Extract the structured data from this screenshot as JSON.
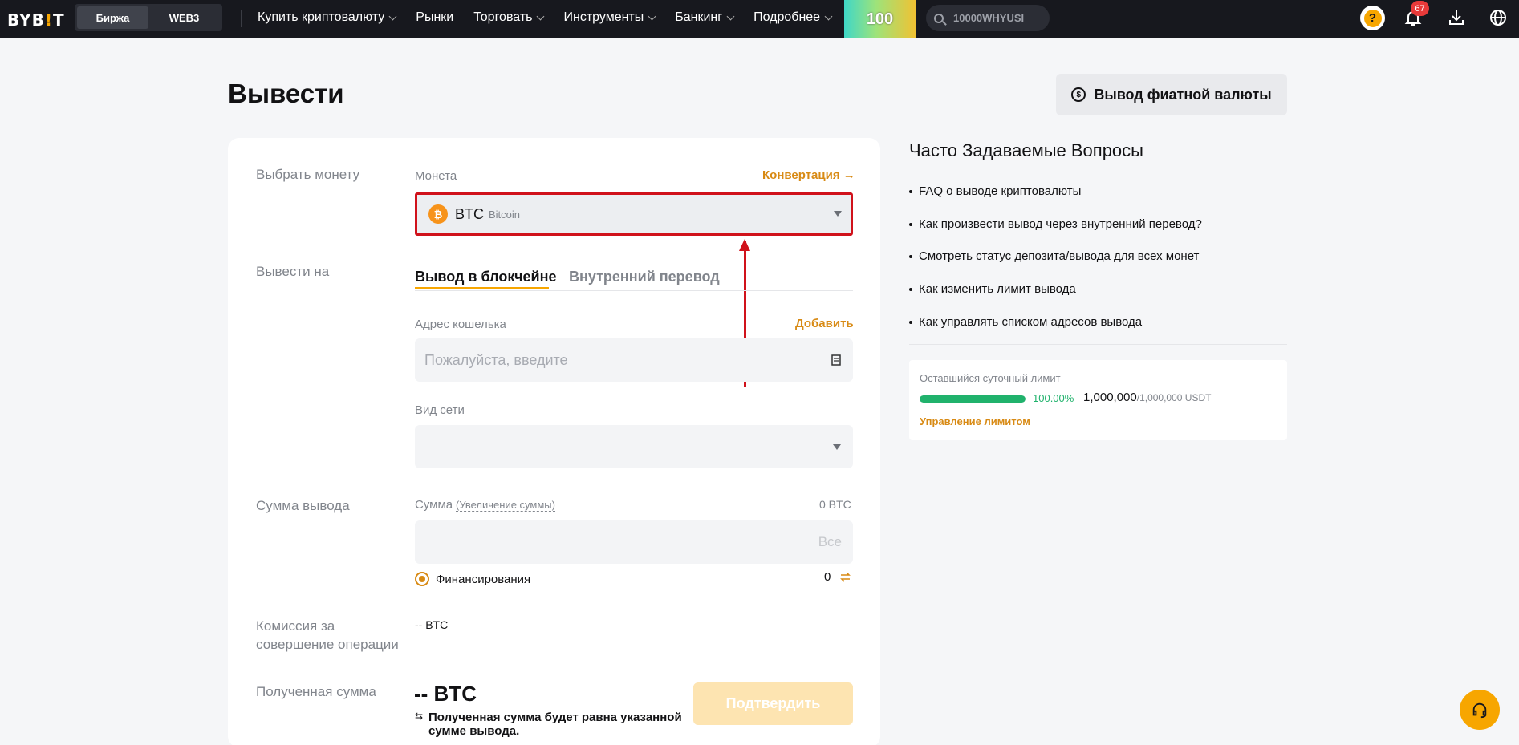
{
  "nav": {
    "logo_main": "BYB",
    "logo_i": "!",
    "logo_end": "T",
    "segments": [
      {
        "label": "Биржа"
      },
      {
        "label": "WEB3"
      }
    ],
    "menu": [
      {
        "label": "Купить криптовалюту",
        "dropdown": true
      },
      {
        "label": "Рынки",
        "dropdown": false
      },
      {
        "label": "Торговать",
        "dropdown": true
      },
      {
        "label": "Инструменты",
        "dropdown": true
      },
      {
        "label": "Банкинг",
        "dropdown": true
      },
      {
        "label": "Подробнее",
        "dropdown": true
      }
    ],
    "promo_text": "100",
    "search_text": "10000WHYUSI",
    "notifications_count": "67",
    "avatar_symbol": "?"
  },
  "page": {
    "title": "Вывести",
    "fiat_button": "Вывод фиатной валюты"
  },
  "form": {
    "select_coin_label": "Выбрать монету",
    "coin_field_label": "Монета",
    "convert_link": "Конвертация",
    "coin_symbol": "BTC",
    "coin_name": "Bitcoin",
    "withdraw_to_label": "Вывести на",
    "tabs": [
      "Вывод в блокчейне",
      "Внутренний перевод"
    ],
    "wallet_label": "Адрес кошелька",
    "add_link": "Добавить",
    "wallet_placeholder": "Пожалуйста, введите",
    "network_label": "Вид сети",
    "amount_section_label": "Сумма вывода",
    "amount_label": "Сумма",
    "amount_increase_link": "(Увеличение суммы)",
    "amount_available": "0 BTC",
    "amount_all": "Все",
    "funding_label": "Финансирования",
    "funding_value": "0",
    "fee_label_line1": "Комиссия за",
    "fee_label_line2": "совершение операции",
    "fee_value": "-- BTC",
    "received_label": "Полученная сумма",
    "received_value": "-- BTC",
    "received_note_line1": "Полученная сумма будет равна указанной",
    "received_note_line2": "сумме вывода.",
    "confirm_button": "Подтвердить"
  },
  "faq": {
    "title": "Часто Задаваемые Вопросы",
    "items": [
      "FAQ о выводе криптовалюты",
      "Как произвести вывод через внутренний перевод?",
      "Смотреть статус депозита/вывода для всех монет",
      "Как изменить лимит вывода",
      "Как управлять списком адресов вывода"
    ]
  },
  "limit": {
    "title": "Оставшийся суточный лимит",
    "percent_text": "100.00%",
    "percent_value": 1.0,
    "remaining": "1,000,000",
    "total": "/1,000,000 USDT",
    "manage_link": "Управление лимитом"
  },
  "colors": {
    "accent": "#f7a600",
    "link": "#d88a14",
    "highlight": "#d0121b",
    "progress": "#20b26c"
  }
}
